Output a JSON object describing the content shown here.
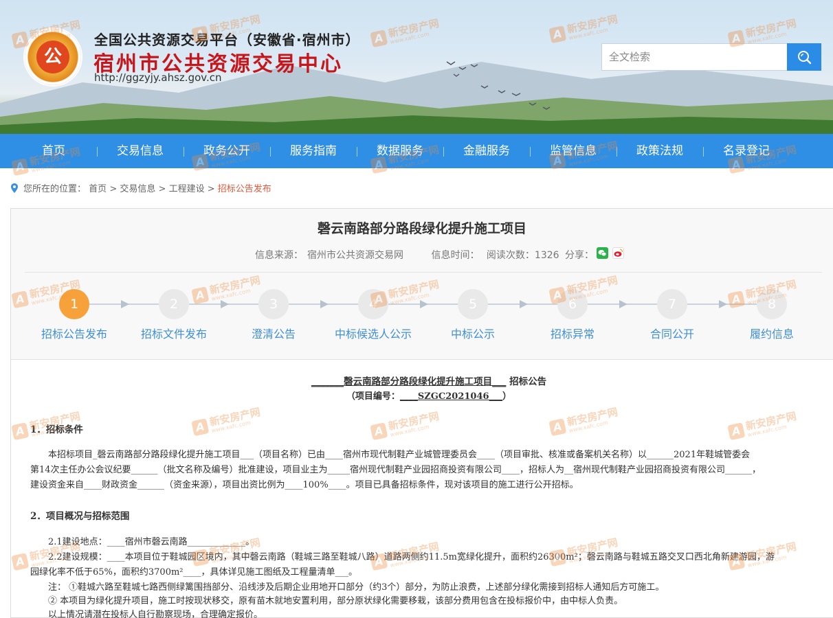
{
  "header": {
    "platform_name": "全国公共资源交易平台（安徽省·宿州市）",
    "center_name": "宿州市公共资源交易中心",
    "url": "http://ggzyjy.ahsz.gov.cn",
    "logo_glyph": "公"
  },
  "search": {
    "placeholder": "全文检索"
  },
  "nav": [
    "首页",
    "交易信息",
    "政务公开",
    "服务指南",
    "数据服务",
    "金融服务",
    "监管信息",
    "政策法规",
    "名录登记"
  ],
  "breadcrumb": {
    "prefix": "您所在的位置：",
    "items": [
      "首页",
      ">",
      "交易信息",
      ">",
      "工程建设",
      ">"
    ],
    "current": "招标公告发布"
  },
  "article": {
    "title": "磬云南路部分路段绿化提升施工项目",
    "source_label": "信息来源：",
    "source": "宿州市公共资源交易网",
    "time_label": "信息时间：",
    "reads_label": "阅读次数：",
    "reads": "1326",
    "share_label": "分享："
  },
  "steps": [
    {
      "num": "1",
      "label": "招标公告发布",
      "active": true
    },
    {
      "num": "2",
      "label": "招标文件发布",
      "active": false
    },
    {
      "num": "3",
      "label": "澄清公告",
      "active": false
    },
    {
      "num": "4",
      "label": "中标候选人公示",
      "active": false
    },
    {
      "num": "5",
      "label": "中标公示",
      "active": false
    },
    {
      "num": "6",
      "label": "招标异常",
      "active": false
    },
    {
      "num": "7",
      "label": "合同公开",
      "active": false
    },
    {
      "num": "8",
      "label": "履约信息",
      "active": false
    }
  ],
  "doc": {
    "ann_title_u": "_______磬云南路部分路段绿化提升施工项目___",
    "ann_title_tail": "招标公告",
    "code_label": "（项目编号：",
    "code_value": "____SZGC2021046___",
    "code_close": "）",
    "sec1": "1．招标条件",
    "p1_line1": "本招标项目_磬云南路部分路段绿化提升施工项目___（项目名称）已由____宿州市现代制鞋产业城管理委员会____（项目审批、核准或备案机关名称）以______2021年鞋城管委会",
    "p1_line2": "第14次主任办公会议纪要______（批文名称及编号）批准建设，项目业主为_____宿州现代制鞋产业园招商投资有限公司____，招标人为__宿州现代制鞋产业园招商投资有限公司______，",
    "p1_line3": "建设资金来自____财政资金______（资金来源），项目出资比例为____100%____。项目已具备招标条件，现对该项目的施工进行公开招标。",
    "sec2": "2．项目概况与招标范围",
    "l21": "2.1建设地点：____宿州市磬云南路_____________。",
    "l22a": "2.2建设规模：____本项目位于鞋城园区境内，其中磬云南路（鞋城三路至鞋城八路）道路两侧约11.5m宽绿化提升，面积约26300m²；磬云南路与鞋城五路交叉口西北角新建游园，游",
    "l22b": "园绿化率不低于65%，面积约3700m²____，具体详见施工图纸及工程量清单___。",
    "note1": "注：  ①鞋城六路至鞋城七路西侧绿篱围挡部分、沿线涉及后期企业用地开口部分（约3个）部分，为防止浪费，上述部分绿化需接到招标人通知后方可施工。",
    "note2": "②  本项目为绿化提升项目，施工时按现状移交，原有苗木就地安置利用，部分原状绿化需要移栽，该部分费用包含在投标报价中，由中标人负责。",
    "note3": "以上情况请潜在投标人自行勘察现场，合理确定报价。"
  },
  "watermark": {
    "title": "新安房产网",
    "url": "www.xafc.com"
  },
  "colors": {
    "nav": "#2f8fe5",
    "accent": "#c6161b",
    "step_active": "#f7a13b",
    "step_label": "#3f8fd6",
    "crumb_current": "#e2573a"
  }
}
